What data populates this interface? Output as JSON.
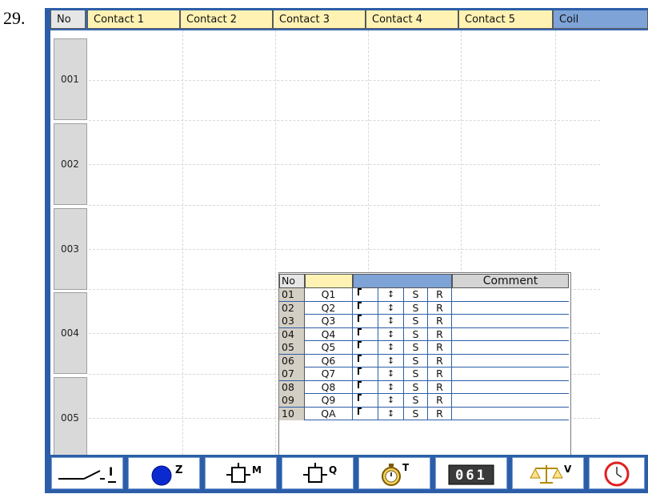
{
  "question_number": "29.",
  "header": {
    "no": "No",
    "contact1": "Contact 1",
    "contact2": "Contact 2",
    "contact3": "Contact 3",
    "contact4": "Contact 4",
    "contact5": "Contact 5",
    "coil": "Coil"
  },
  "rows": [
    "001",
    "002",
    "003",
    "004",
    "005"
  ],
  "popup": {
    "col_no": "No",
    "col_comment": "Comment",
    "set_label": "S",
    "reset_label": "R",
    "items": [
      {
        "no": "01",
        "name": "Q1"
      },
      {
        "no": "02",
        "name": "Q2"
      },
      {
        "no": "03",
        "name": "Q3"
      },
      {
        "no": "04",
        "name": "Q4"
      },
      {
        "no": "05",
        "name": "Q5"
      },
      {
        "no": "06",
        "name": "Q6"
      },
      {
        "no": "07",
        "name": "Q7"
      },
      {
        "no": "08",
        "name": "Q8"
      },
      {
        "no": "09",
        "name": "Q9"
      },
      {
        "no": "10",
        "name": "QA"
      }
    ]
  },
  "toolbar": {
    "input": "I",
    "z": "Z",
    "m": "M",
    "q": "Q",
    "t": "T",
    "counter_digits": "061",
    "v": "V"
  },
  "colors": {
    "frame_blue": "#2c5ea8",
    "header_yellow": "#fff2b3",
    "coil_blue": "#7ea3d6",
    "row_label_gray": "#d9d9d9"
  }
}
